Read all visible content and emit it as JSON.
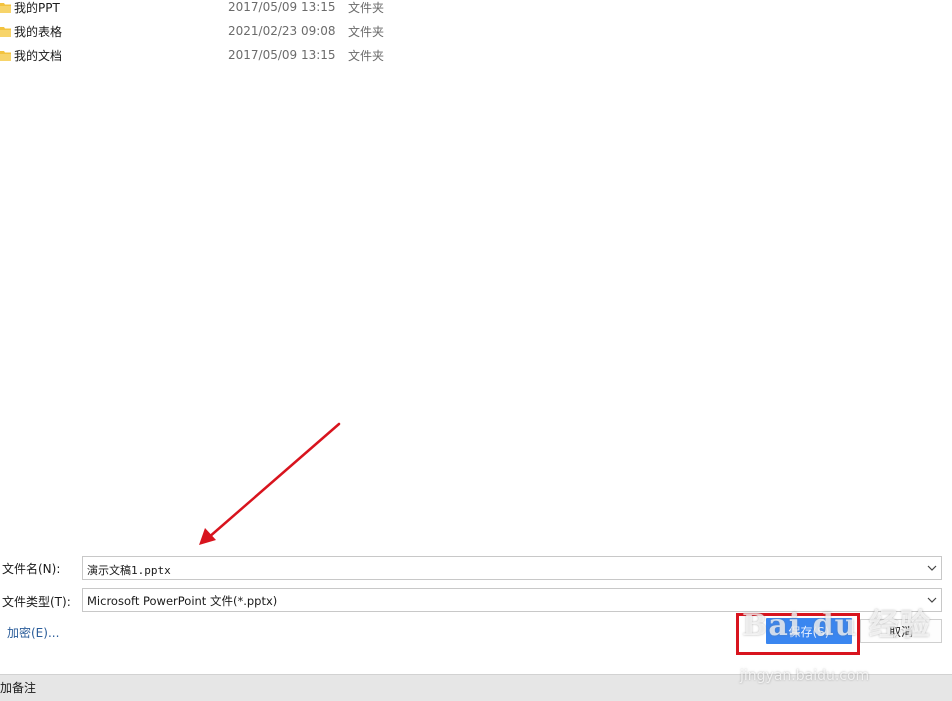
{
  "files": [
    {
      "name": "我的PPT",
      "date": "2017/05/09 13:15",
      "type": "文件夹"
    },
    {
      "name": "我的表格",
      "date": "2021/02/23 09:08",
      "type": "文件夹"
    },
    {
      "name": "我的文档",
      "date": "2017/05/09 13:15",
      "type": "文件夹"
    }
  ],
  "form": {
    "filename_label": "文件名(N):",
    "filename_value": "演示文稿1.pptx",
    "filetype_label": "文件类型(T):",
    "filetype_value": "Microsoft PowerPoint 文件(*.pptx)",
    "encrypt_link": "加密(E)..."
  },
  "buttons": {
    "save_label": "保存(S)",
    "cancel_label": "取消"
  },
  "bottom_bar": {
    "notes_label": "加备注"
  },
  "watermark": {
    "logo_text": "Bai du 经验",
    "url_text": "jingyan.baidu.com"
  },
  "colors": {
    "folder": "#f3c33f",
    "save_button": "#3a86f0",
    "highlight": "#d8141e",
    "arrow": "#d8141e",
    "link": "#2b5d9a"
  },
  "icons": {
    "folder": "folder-icon",
    "dropdown": "chevron-down-icon",
    "annotation_arrow": "arrow-icon"
  }
}
